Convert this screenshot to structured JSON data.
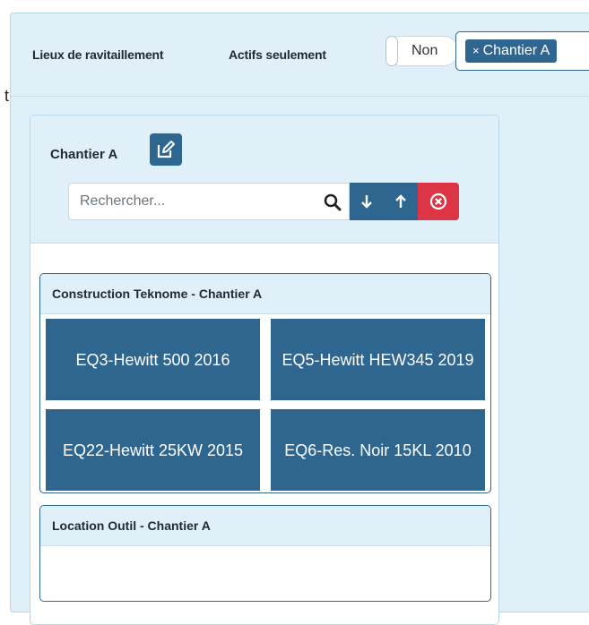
{
  "filter_bar": {
    "label_locations": "Lieux de ravitaillement",
    "label_active_only": "Actifs seulement",
    "toggle_value": "Non",
    "selected_chip": "Chantier A",
    "chip_remove_glyph": "×"
  },
  "stray_text": "t",
  "site": {
    "title": "Chantier A",
    "edit_icon": "edit-icon",
    "search": {
      "placeholder": "Rechercher...",
      "value": ""
    },
    "groups": [
      {
        "title": "Construction Teknome - Chantier A",
        "equipment": [
          {
            "label": "EQ3-Hewitt 500 2016"
          },
          {
            "label": "EQ5-Hewitt HEW345 2019"
          },
          {
            "label": "EQ22-Hewitt 25KW 2015"
          },
          {
            "label": "EQ6-Res. Noir 15KL 2010"
          }
        ]
      },
      {
        "title": "Location Outil - Chantier A",
        "equipment": []
      }
    ]
  },
  "colors": {
    "primary": "#2f6690",
    "panel_bg": "#dff0f9",
    "danger": "#dc3545"
  }
}
